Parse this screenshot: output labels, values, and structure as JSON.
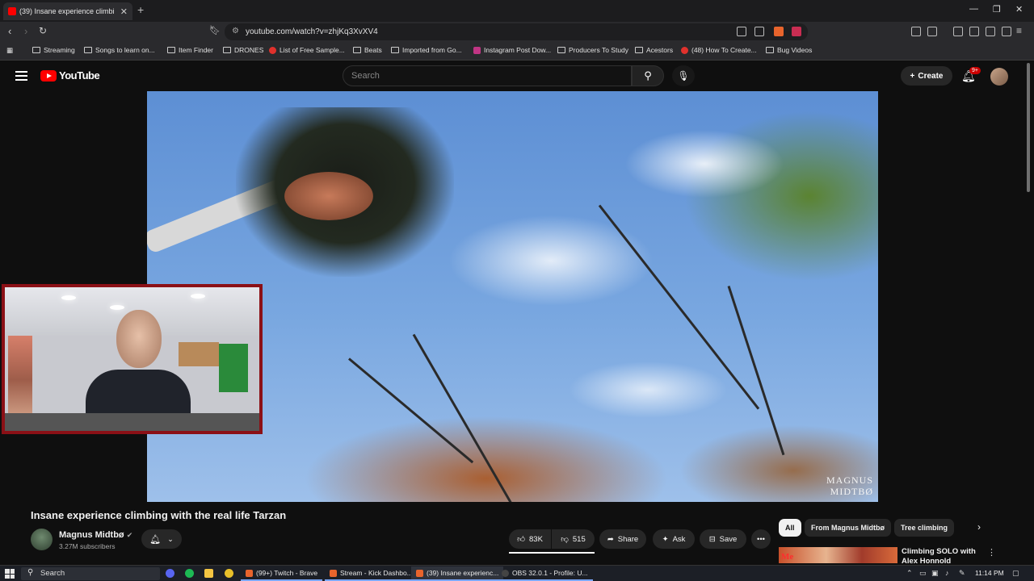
{
  "browser": {
    "tab_title": "(39) Insane experience climbi",
    "url": "youtube.com/watch?v=zhjKq3XvXV4",
    "bookmarks": [
      "Streaming",
      "Songs to learn on...",
      "Item Finder",
      "DRONES",
      "List of Free Sample...",
      "Beats",
      "Imported from Go...",
      "Instagram Post Dow...",
      "Producers To Study",
      "Acestors",
      "(48) How To Create...",
      "Bug Videos"
    ]
  },
  "youtube": {
    "logo_text": "YouTube",
    "search_placeholder": "Search",
    "create_label": "Create",
    "notification_badge": "9+"
  },
  "video": {
    "watermark_line1": "MAGNUS",
    "watermark_line2": "MIDTBØ",
    "title": "Insane experience climbing with the real life Tarzan",
    "channel_name": "Magnus Midtbø",
    "subscribers": "3.27M subscribers",
    "likes": "83K",
    "dislikes": "515",
    "share_label": "Share",
    "ask_label": "Ask",
    "save_label": "Save"
  },
  "chips": [
    "All",
    "From Magnus Midtbø",
    "Tree climbing"
  ],
  "recommendation": {
    "thumb_text": "Me",
    "title": "Climbing SOLO with Alex Honnold"
  },
  "taskbar": {
    "search_placeholder": "Search",
    "apps": [
      "(99+) Twitch - Brave",
      "Stream - Kick Dashbo...",
      "(39) Insane experienc...",
      "OBS 32.0.1 - Profile: U..."
    ],
    "time": "11:14 PM"
  },
  "colors": {
    "yt_red": "#ff0000",
    "background": "#0f0f0f",
    "webcam_border": "#8b1016"
  }
}
